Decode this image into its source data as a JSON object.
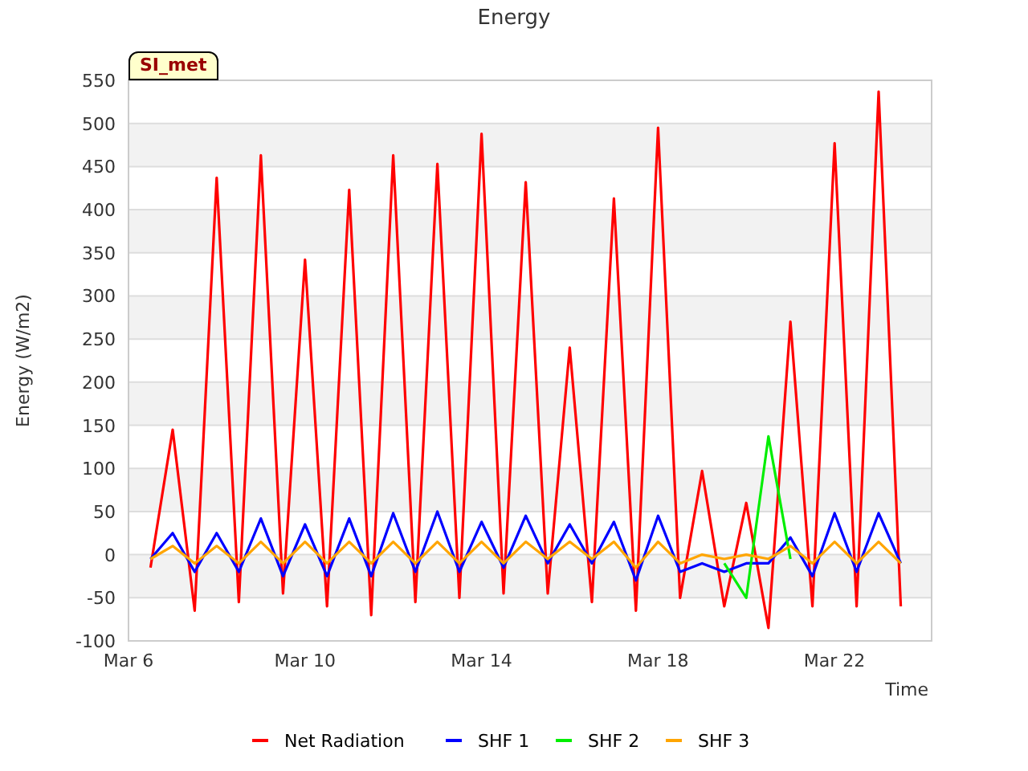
{
  "badge": "SI_met",
  "chart_data": {
    "type": "line",
    "title": "Energy",
    "xlabel": "Time",
    "ylabel": "Energy (W/m2)",
    "categories": [
      "Mar 6",
      null,
      null,
      null,
      null,
      null,
      null,
      null,
      "Mar 10",
      null,
      null,
      null,
      null,
      null,
      null,
      null,
      "Mar 14",
      null,
      null,
      null,
      null,
      null,
      null,
      null,
      "Mar 18",
      null,
      null,
      null,
      null,
      null,
      null,
      null,
      "Mar 22",
      null,
      null,
      null,
      null
    ],
    "series": [
      {
        "name": "Net Radiation",
        "color": "#ff0000",
        "values": [
          null,
          -15,
          145,
          -65,
          437,
          -55,
          463,
          -45,
          342,
          -60,
          423,
          -70,
          463,
          -55,
          453,
          -50,
          488,
          -45,
          432,
          -45,
          240,
          -55,
          413,
          -65,
          495,
          -50,
          97,
          -60,
          60,
          -85,
          270,
          -60,
          477,
          -60,
          537,
          -60,
          null
        ]
      },
      {
        "name": "SHF 1",
        "color": "#0000ff",
        "values": [
          null,
          -5,
          25,
          -20,
          25,
          -20,
          42,
          -25,
          35,
          -25,
          42,
          -25,
          48,
          -20,
          50,
          -20,
          38,
          -15,
          45,
          -10,
          35,
          -10,
          38,
          -30,
          45,
          -20,
          -10,
          -20,
          -10,
          -10,
          20,
          -25,
          48,
          -20,
          48,
          -10,
          null
        ]
      },
      {
        "name": "SHF 2",
        "color": "#00ee00",
        "values": [
          null,
          null,
          null,
          null,
          null,
          null,
          null,
          null,
          null,
          null,
          null,
          null,
          null,
          null,
          null,
          null,
          null,
          null,
          null,
          null,
          null,
          null,
          null,
          null,
          null,
          null,
          null,
          -10,
          -50,
          137,
          -5,
          null,
          null,
          null,
          null,
          null,
          null
        ]
      },
      {
        "name": "SHF 3",
        "color": "#ffa500",
        "values": [
          null,
          -5,
          10,
          -10,
          10,
          -10,
          15,
          -10,
          15,
          -10,
          15,
          -10,
          15,
          -10,
          15,
          -10,
          15,
          -10,
          15,
          -5,
          15,
          -5,
          15,
          -15,
          15,
          -10,
          0,
          -5,
          0,
          -5,
          10,
          -10,
          15,
          -10,
          15,
          -10,
          null
        ]
      }
    ],
    "ylim": [
      -100,
      550
    ],
    "grid": true,
    "legend": "bottom",
    "yticks": [
      -100,
      -50,
      0,
      50,
      100,
      150,
      200,
      250,
      300,
      350,
      400,
      450,
      500,
      550
    ]
  }
}
